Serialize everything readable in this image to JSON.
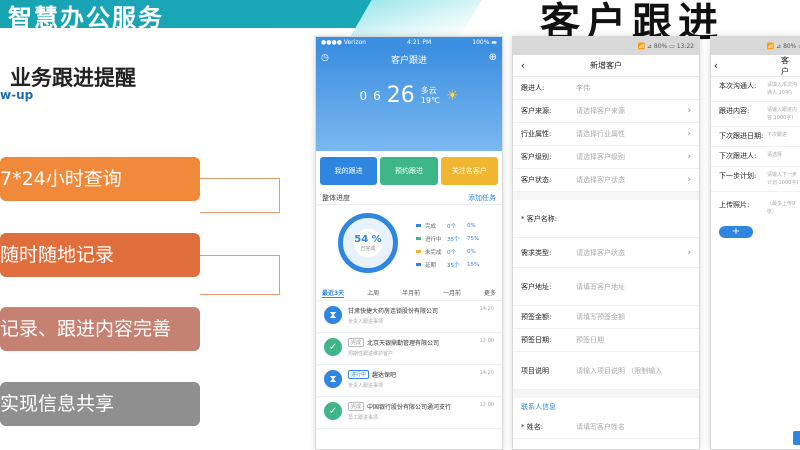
{
  "header": {
    "band_title": "智慧办公服务",
    "page_title": "客户跟进"
  },
  "left": {
    "heading": "业务跟进提醒",
    "sub": "w-up",
    "features": [
      "7*24小时查询",
      "随时随地记录",
      "记录、跟进内容完善",
      "实现信息共享"
    ]
  },
  "phone1": {
    "status": {
      "carrier": "●●●● Verizon",
      "time": "4:21 PM",
      "battery": "100% ▬"
    },
    "title": "客户跟进",
    "weather": {
      "date_left": "0",
      "date_right": "6",
      "temp": "26",
      "unit_top": "多云",
      "unit_bottom": "19℃"
    },
    "buttons": [
      "我的跟进",
      "预约跟进",
      "关注名客户"
    ],
    "overview": {
      "label": "整体进度",
      "link": "添加任务"
    },
    "gauge": {
      "value": "54 %",
      "label": "已完成"
    },
    "legend": [
      {
        "name": "完成",
        "a": "0个",
        "b": "0%",
        "color": "#2f86e0"
      },
      {
        "name": "进行中",
        "a": "35个",
        "b": "75%",
        "color": "#3fb58a"
      },
      {
        "name": "未完成",
        "a": "0个",
        "b": "0%",
        "color": "#f0b62f"
      },
      {
        "name": "延期",
        "a": "35个",
        "b": "15%",
        "color": "#2f86e0"
      }
    ],
    "tabs": [
      "最近3天",
      "上周",
      "半月前",
      "一月前",
      "更多"
    ],
    "tasks": [
      {
        "status": "pend",
        "tag": "",
        "title": "甘肃快捷大药房连锁股份有限公司",
        "sub": "负责人跟进事项",
        "time": "14:20"
      },
      {
        "status": "done",
        "tag": "完成",
        "title": "北京天银鼎勤管理有限公司",
        "sub": "周期性跟进维护客户",
        "time": "12:00"
      },
      {
        "status": "pend",
        "tag": "进行中",
        "title": "趣达保吧",
        "sub": "负责人跟进事项",
        "time": "14:20"
      },
      {
        "status": "done",
        "tag": "完成",
        "title": "中国银行股份有限公司通河支行",
        "sub": "员工跟进事项",
        "time": "12:00"
      }
    ]
  },
  "phone2": {
    "status": "📶 ⊿ 80% ▭ 13:22",
    "title": "新增客户",
    "fields": [
      {
        "label": "跟进人:",
        "value": "李伟",
        "arrow": false
      },
      {
        "label": "客户来源:",
        "value": "请选择客户来源",
        "arrow": true
      },
      {
        "label": "行业属性:",
        "value": "请选择行业属性",
        "arrow": true
      },
      {
        "label": "客户级别:",
        "value": "请选择客户级别",
        "arrow": true
      },
      {
        "label": "客户状态:",
        "value": "请选择客户状态",
        "arrow": true
      }
    ],
    "fields2": [
      {
        "label": "* 客户名称:",
        "value": "",
        "arrow": false,
        "size": "tall"
      },
      {
        "label": "需求类型:",
        "value": "请选择客户状态",
        "arrow": true,
        "size": "mid"
      },
      {
        "label": "客户地址:",
        "value": "请填写客户地址",
        "arrow": false,
        "size": "tall"
      },
      {
        "label": "预签金额:",
        "value": "请填写预签金额",
        "arrow": false,
        "size": ""
      },
      {
        "label": "预签日期:",
        "value": "预签日期",
        "arrow": false,
        "size": ""
      },
      {
        "label": "项目说明",
        "value": "请输入项目说明 （限制输入",
        "arrow": false,
        "size": "tall"
      }
    ],
    "contact_section": "联系人信息",
    "contact_field": {
      "label": "* 姓名:",
      "value": "请填写客户姓名"
    }
  },
  "phone3": {
    "status": "📶 ⊿ 80% ▭",
    "title": "客户",
    "rows": [
      {
        "label": "本次沟通人:",
        "value": "请填入本次沟通人 20字)"
      },
      {
        "label": "跟进内容:",
        "value": "请输入跟进内容 1000字)"
      },
      {
        "label": "下次跟进日期:",
        "value": "下次跟进"
      },
      {
        "label": "下次跟进人:",
        "value": "请选择"
      },
      {
        "label": "下一步计划:",
        "value": "请输入下一步计划 1000字)"
      }
    ],
    "upload": {
      "label": "上传照片:",
      "hint": "（最多上传9张）"
    },
    "add": "+"
  }
}
